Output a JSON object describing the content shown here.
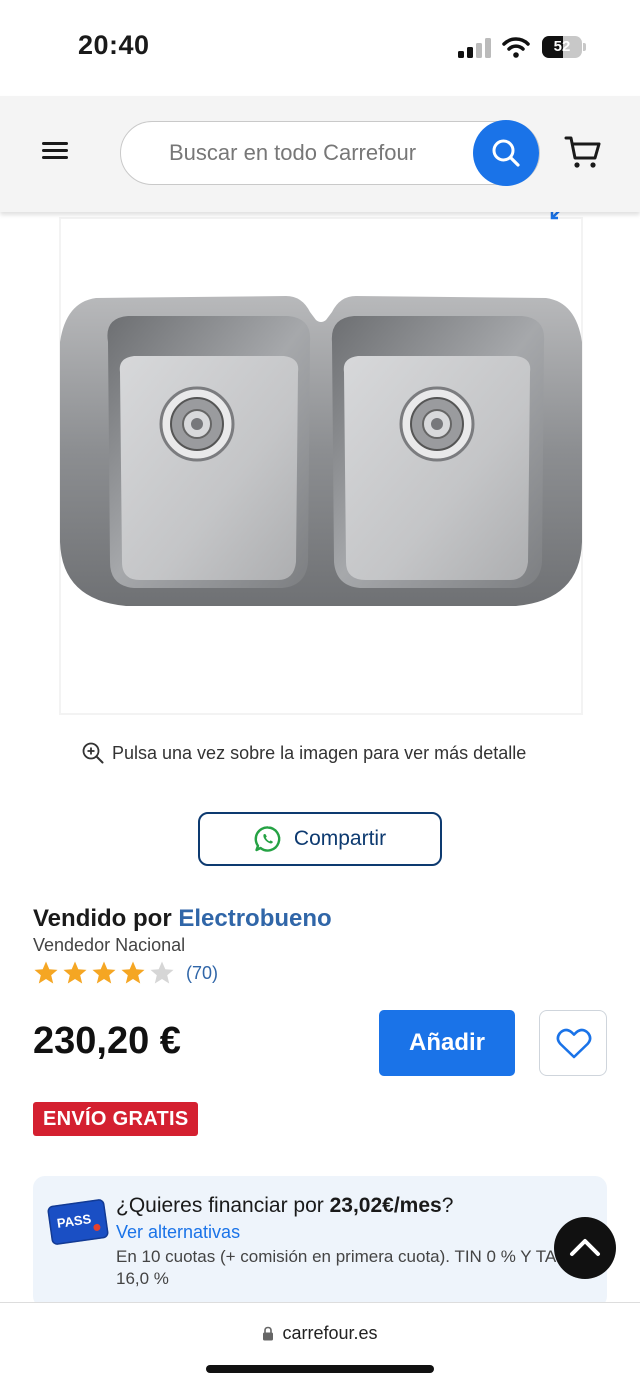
{
  "status_bar": {
    "time": "20:40",
    "battery_level": "52",
    "battery_fraction": 0.52
  },
  "header": {
    "menu_icon": "hamburger-menu-icon",
    "search_placeholder": "Buscar en todo Carrefour",
    "search_icon": "search-icon",
    "cart_icon": "cart-icon"
  },
  "product": {
    "image_icon": "double-sink-image",
    "zoom_hint": "Pulsa una vez sobre la imagen para ver más detalle",
    "share_label": "Compartir",
    "seller_prefix": "Vendido por",
    "seller_name": "Electrobueno",
    "seller_type": "Vendedor Nacional",
    "rating_stars": 4,
    "rating_max": 5,
    "rating_count": "(70)",
    "price": "230,20 €",
    "add_label": "Añadir",
    "free_shipping": "ENVÍO GRATIS"
  },
  "finance": {
    "badge_text": "PASS",
    "title_prefix": "¿Quieres financiar por ",
    "title_amount": "23,02€/mes",
    "title_suffix": "?",
    "link": "Ver alternativas",
    "detail": "En 10 cuotas (+ comisión en primera cuota). TIN 0 % Y TAE 16,0 %"
  },
  "browser": {
    "url": "carrefour.es"
  },
  "colors": {
    "accent_blue": "#1a73e8",
    "seller_blue": "#3066a8",
    "badge_red": "#d42030",
    "star_gold": "#f5a623"
  }
}
